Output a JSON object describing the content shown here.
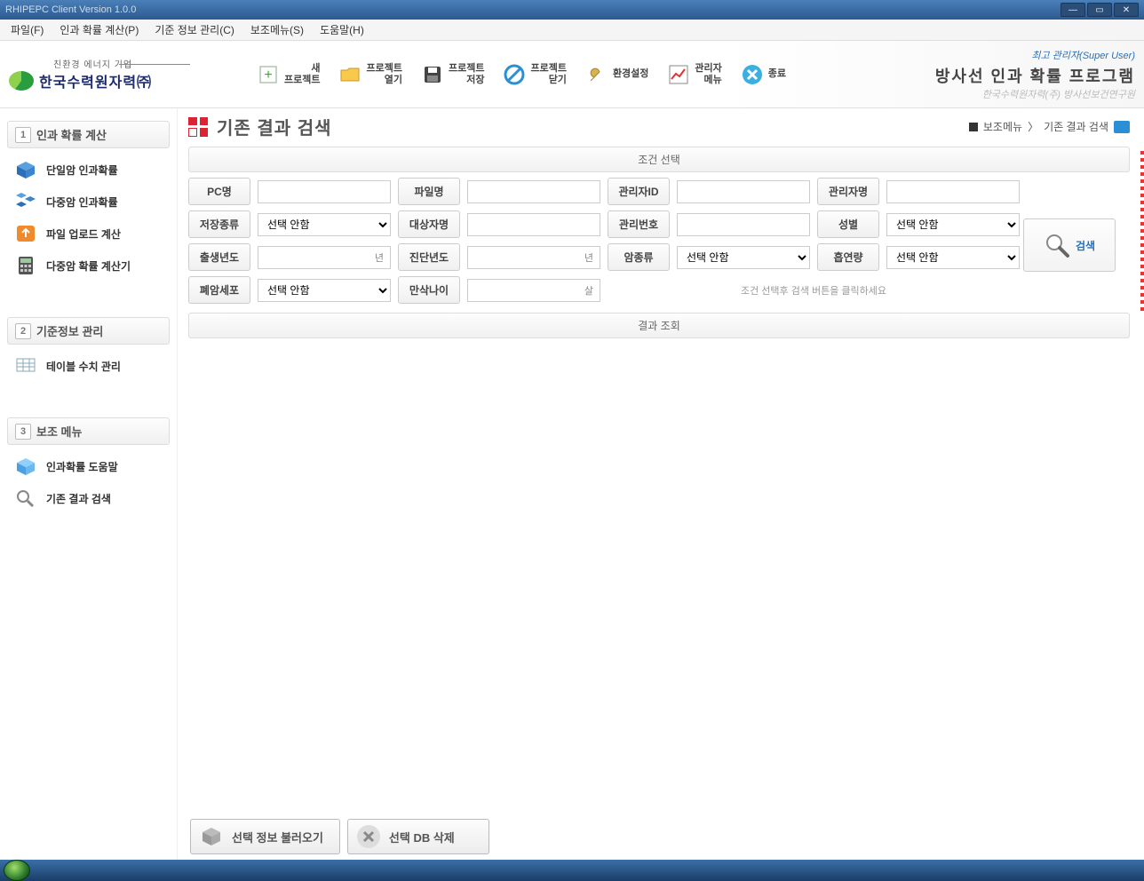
{
  "window": {
    "title": "RHIPEPC Client Version 1.0.0"
  },
  "menubar": [
    "파일(F)",
    "인과 확률 계산(P)",
    "기준 정보 관리(C)",
    "보조메뉴(S)",
    "도움말(H)"
  ],
  "logo": {
    "tagline": "친환경 에너지 기업",
    "company": "한국수력원자력㈜"
  },
  "toolbar": {
    "new_project": "새\n프로젝트",
    "open_project": "프로젝트\n열기",
    "save_project": "프로젝트\n저장",
    "close_project": "프로젝트\n닫기",
    "settings": "환경설정",
    "admin_menu": "관리자\n메뉴",
    "exit": "종료"
  },
  "header": {
    "super_user": "최고 관리자(Super User)",
    "app_title": "방사선 인과 확률 프로그램",
    "app_subtitle": "한국수력원자력(주) 방사선보건연구원"
  },
  "sidebar": {
    "section1": {
      "num": "1",
      "title": "인과 확률 계산",
      "items": [
        "단일암 인과확률",
        "다중암 인과확률",
        "파일 업로드 계산",
        "다중암 확률 계산기"
      ]
    },
    "section2": {
      "num": "2",
      "title": "기준정보 관리",
      "items": [
        "테이블 수치 관리"
      ]
    },
    "section3": {
      "num": "3",
      "title": "보조 메뉴",
      "items": [
        "인과확률 도움말",
        "기존 결과 검색"
      ]
    }
  },
  "page": {
    "title": "기존 결과 검색",
    "breadcrumb_root": "보조메뉴",
    "breadcrumb_leaf": "기존 결과 검색"
  },
  "panels": {
    "condition": "조건 선택",
    "results": "결과 조회"
  },
  "labels": {
    "pc_name": "PC명",
    "file_name": "파일명",
    "admin_id": "관리자ID",
    "admin_name": "관리자명",
    "storage_type": "저장종류",
    "subject_name": "대상자명",
    "manage_no": "관리번호",
    "gender": "성별",
    "birth_year": "출생년도",
    "diag_year": "진단년도",
    "cancer_type": "암종류",
    "smoking": "흡연량",
    "lung_cell": "폐암세포",
    "full_age": "만삭나이"
  },
  "units": {
    "year": "년",
    "age": "살"
  },
  "select_default": "선택 안함",
  "hint": "조건 선택후 검색 버튼을 클릭하세요",
  "search_label": "검색",
  "bottom": {
    "load": "선택 정보 불러오기",
    "delete": "선택 DB 삭제"
  }
}
